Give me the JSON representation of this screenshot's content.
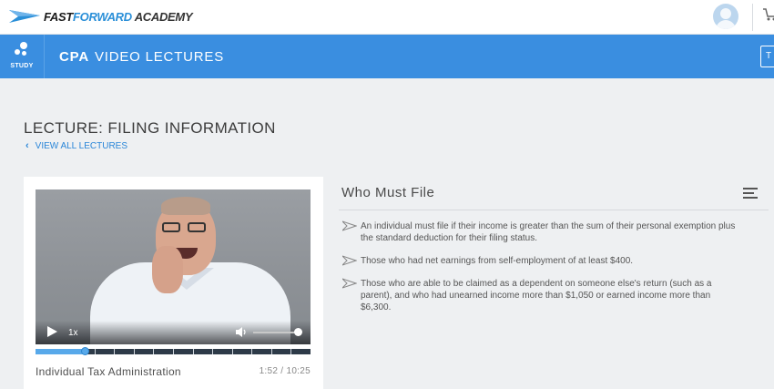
{
  "brand": {
    "logo_text_part1": "FAST",
    "logo_text_part2": "FORWARD",
    "logo_text_part3": "ACADEMY",
    "accent_color": "#3a8ee0"
  },
  "header": {
    "avatar_icon": "user-avatar-icon",
    "cart_icon": "cart-icon"
  },
  "nav": {
    "study_label": "STUDY",
    "title_bold": "CPA",
    "title_rest": "VIDEO LECTURES",
    "right_button_label": "T"
  },
  "lecture": {
    "title": "LECTURE: FILING INFORMATION",
    "view_all_label": "VIEW ALL LECTURES"
  },
  "video": {
    "playback_rate": "1x",
    "progress_fraction": 0.18,
    "volume_fraction": 0.95,
    "title": "Individual Tax Administration",
    "time": "1:52 / 10:25"
  },
  "content": {
    "section_title": "Who Must File",
    "bullets": [
      "An individual must file if their income is greater than the sum of their personal exemption plus the standard deduction for their filing status.",
      "Those who had net earnings from self-employment of at least $400.",
      "Those who are able to be claimed as a dependent on someone else's return (such as a parent), and who had unearned income more than $1,050 or earned income more than $6,300."
    ]
  }
}
